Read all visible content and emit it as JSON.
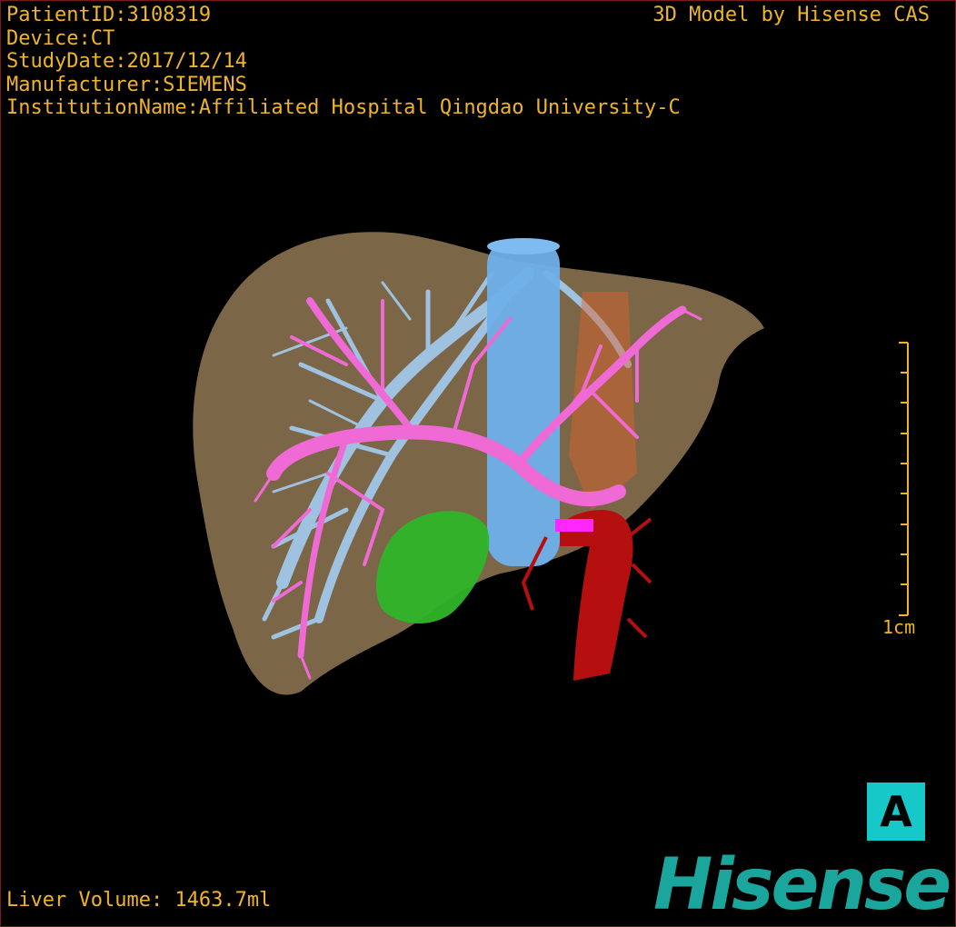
{
  "header": {
    "patient_id": "PatientID:3108319",
    "device": "Device:CT",
    "study_date": "StudyDate:2017/12/14",
    "manufacturer": "Manufacturer:SIEMENS",
    "institution": "InstitutionName:Affiliated Hospital Qingdao University-C",
    "credit": "3D Model by Hisense CAS"
  },
  "footer": {
    "liver_volume": "Liver Volume: 1463.7ml",
    "logo_text": "Hisense"
  },
  "scale_bar": {
    "label": "1cm"
  },
  "orientation": {
    "label": "A"
  },
  "colors": {
    "background": "#000000",
    "overlay_text": "#f0b429",
    "liver": "#8a7150",
    "hepatic_vein": "#9fc2e0",
    "portal_vein": "#f06ad6",
    "ivc": "#6fb0ea",
    "aorta": "#b5100f",
    "tumor": "#2fb52a",
    "orientation_box": "#16c8c8",
    "logo": "#1aa69c"
  },
  "model_structures": [
    "liver",
    "hepatic-vein",
    "portal-vein",
    "inferior-vena-cava",
    "aorta",
    "lesion"
  ]
}
